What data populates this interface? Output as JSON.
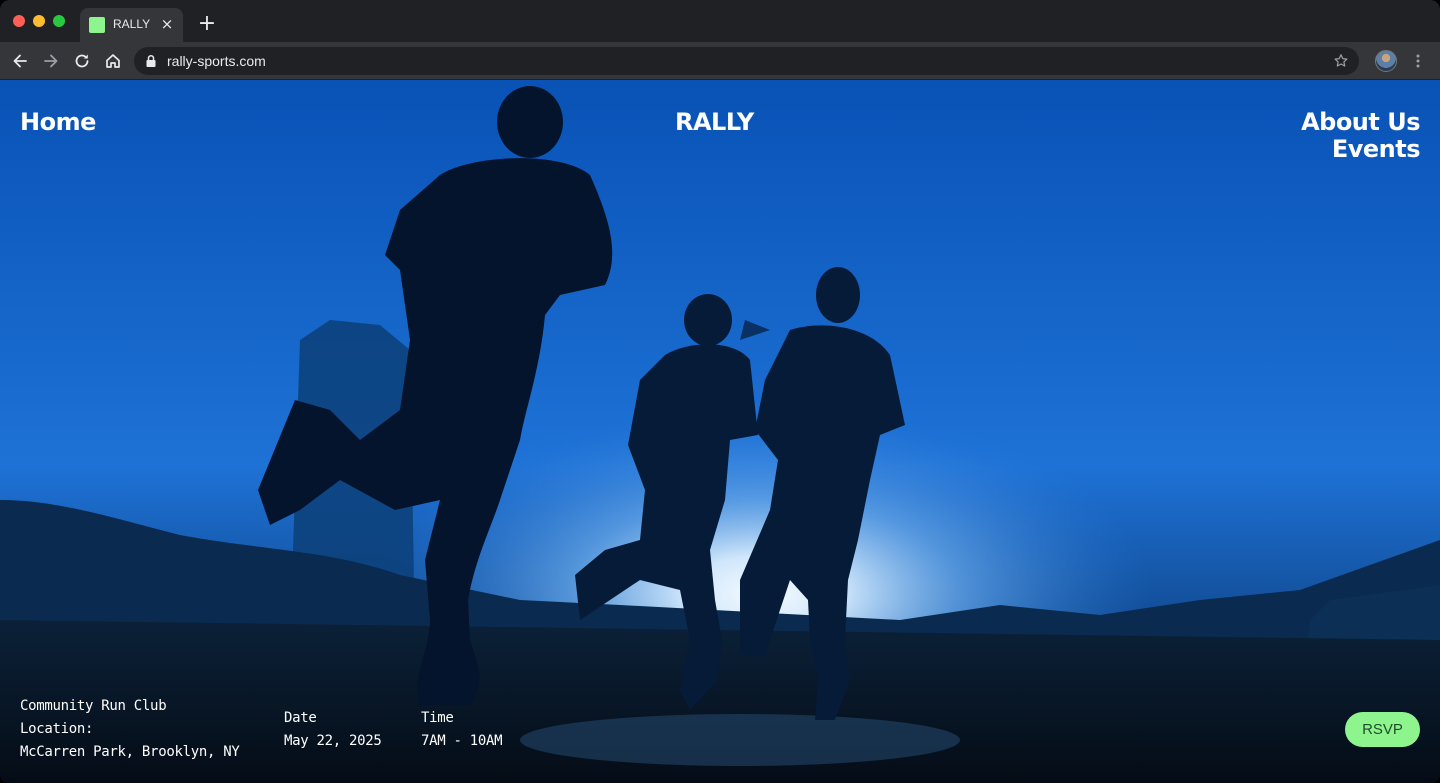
{
  "browser": {
    "tab_title": "RALLY",
    "tab_close_glyph": "×",
    "new_tab_glyph": "+",
    "url": "rally-sports.com",
    "accent": "#8ef58e"
  },
  "nav": {
    "home": "Home",
    "brand": "RALLY",
    "about": "About Us",
    "events": "Events"
  },
  "event": {
    "name": "Community Run Club",
    "location_label": "Location:",
    "location": "McCarren Park, Brooklyn, NY",
    "date_label": "Date",
    "date": "May 22, 2025",
    "time_label": "Time",
    "time": "7AM - 10AM"
  },
  "rsvp_label": "RSVP",
  "hero_image": {
    "description_icon": "runners-silhouette-photo",
    "sky_color": "#0a50b0",
    "sun_color": "#dff2ff"
  }
}
